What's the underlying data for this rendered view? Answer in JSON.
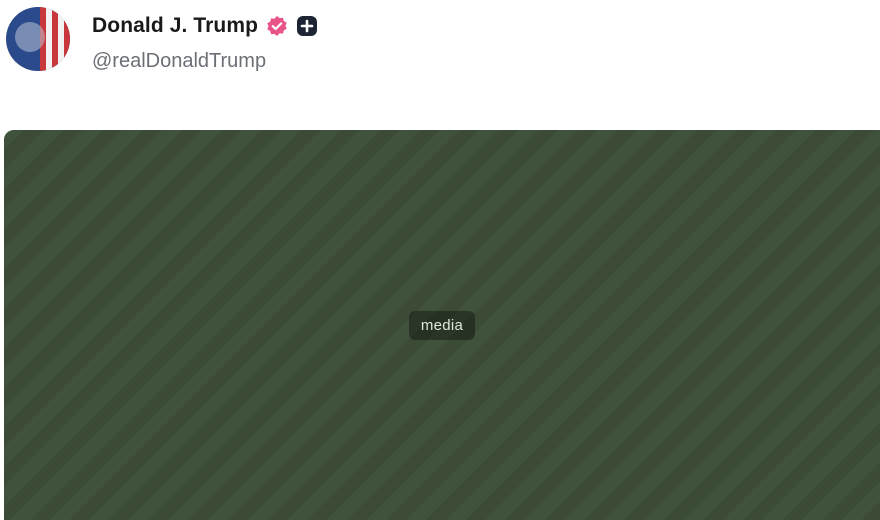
{
  "post": {
    "author": {
      "display_name": "Donald J. Trump",
      "handle": "@realDonaldTrump",
      "verified": true,
      "badges": [
        "verified-icon",
        "plus-badge-icon"
      ]
    },
    "media": {
      "kind": "video-still"
    }
  },
  "colors": {
    "verified_badge": "#e8548a",
    "plus_badge": "#1d2433",
    "handle_text": "#6b6f76",
    "name_text": "#1a1a1a"
  }
}
